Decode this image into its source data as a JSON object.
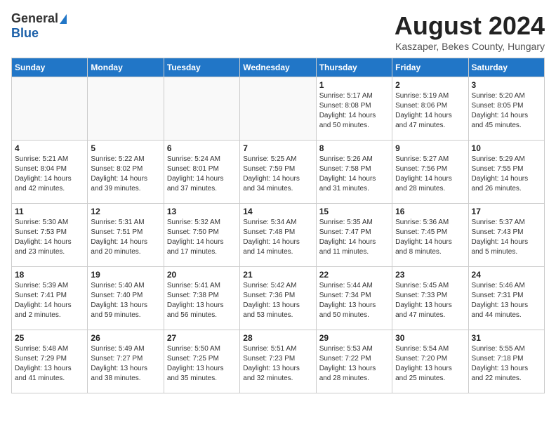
{
  "header": {
    "logo_general": "General",
    "logo_blue": "Blue",
    "month_title": "August 2024",
    "location": "Kaszaper, Bekes County, Hungary"
  },
  "days_of_week": [
    "Sunday",
    "Monday",
    "Tuesday",
    "Wednesday",
    "Thursday",
    "Friday",
    "Saturday"
  ],
  "weeks": [
    [
      {
        "day": "",
        "empty": true
      },
      {
        "day": "",
        "empty": true
      },
      {
        "day": "",
        "empty": true
      },
      {
        "day": "",
        "empty": true
      },
      {
        "day": "1",
        "sunrise": "5:17 AM",
        "sunset": "8:08 PM",
        "daylight": "14 hours and 50 minutes."
      },
      {
        "day": "2",
        "sunrise": "5:19 AM",
        "sunset": "8:06 PM",
        "daylight": "14 hours and 47 minutes."
      },
      {
        "day": "3",
        "sunrise": "5:20 AM",
        "sunset": "8:05 PM",
        "daylight": "14 hours and 45 minutes."
      }
    ],
    [
      {
        "day": "4",
        "sunrise": "5:21 AM",
        "sunset": "8:04 PM",
        "daylight": "14 hours and 42 minutes."
      },
      {
        "day": "5",
        "sunrise": "5:22 AM",
        "sunset": "8:02 PM",
        "daylight": "14 hours and 39 minutes."
      },
      {
        "day": "6",
        "sunrise": "5:24 AM",
        "sunset": "8:01 PM",
        "daylight": "14 hours and 37 minutes."
      },
      {
        "day": "7",
        "sunrise": "5:25 AM",
        "sunset": "7:59 PM",
        "daylight": "14 hours and 34 minutes."
      },
      {
        "day": "8",
        "sunrise": "5:26 AM",
        "sunset": "7:58 PM",
        "daylight": "14 hours and 31 minutes."
      },
      {
        "day": "9",
        "sunrise": "5:27 AM",
        "sunset": "7:56 PM",
        "daylight": "14 hours and 28 minutes."
      },
      {
        "day": "10",
        "sunrise": "5:29 AM",
        "sunset": "7:55 PM",
        "daylight": "14 hours and 26 minutes."
      }
    ],
    [
      {
        "day": "11",
        "sunrise": "5:30 AM",
        "sunset": "7:53 PM",
        "daylight": "14 hours and 23 minutes."
      },
      {
        "day": "12",
        "sunrise": "5:31 AM",
        "sunset": "7:51 PM",
        "daylight": "14 hours and 20 minutes."
      },
      {
        "day": "13",
        "sunrise": "5:32 AM",
        "sunset": "7:50 PM",
        "daylight": "14 hours and 17 minutes."
      },
      {
        "day": "14",
        "sunrise": "5:34 AM",
        "sunset": "7:48 PM",
        "daylight": "14 hours and 14 minutes."
      },
      {
        "day": "15",
        "sunrise": "5:35 AM",
        "sunset": "7:47 PM",
        "daylight": "14 hours and 11 minutes."
      },
      {
        "day": "16",
        "sunrise": "5:36 AM",
        "sunset": "7:45 PM",
        "daylight": "14 hours and 8 minutes."
      },
      {
        "day": "17",
        "sunrise": "5:37 AM",
        "sunset": "7:43 PM",
        "daylight": "14 hours and 5 minutes."
      }
    ],
    [
      {
        "day": "18",
        "sunrise": "5:39 AM",
        "sunset": "7:41 PM",
        "daylight": "14 hours and 2 minutes."
      },
      {
        "day": "19",
        "sunrise": "5:40 AM",
        "sunset": "7:40 PM",
        "daylight": "13 hours and 59 minutes."
      },
      {
        "day": "20",
        "sunrise": "5:41 AM",
        "sunset": "7:38 PM",
        "daylight": "13 hours and 56 minutes."
      },
      {
        "day": "21",
        "sunrise": "5:42 AM",
        "sunset": "7:36 PM",
        "daylight": "13 hours and 53 minutes."
      },
      {
        "day": "22",
        "sunrise": "5:44 AM",
        "sunset": "7:34 PM",
        "daylight": "13 hours and 50 minutes."
      },
      {
        "day": "23",
        "sunrise": "5:45 AM",
        "sunset": "7:33 PM",
        "daylight": "13 hours and 47 minutes."
      },
      {
        "day": "24",
        "sunrise": "5:46 AM",
        "sunset": "7:31 PM",
        "daylight": "13 hours and 44 minutes."
      }
    ],
    [
      {
        "day": "25",
        "sunrise": "5:48 AM",
        "sunset": "7:29 PM",
        "daylight": "13 hours and 41 minutes."
      },
      {
        "day": "26",
        "sunrise": "5:49 AM",
        "sunset": "7:27 PM",
        "daylight": "13 hours and 38 minutes."
      },
      {
        "day": "27",
        "sunrise": "5:50 AM",
        "sunset": "7:25 PM",
        "daylight": "13 hours and 35 minutes."
      },
      {
        "day": "28",
        "sunrise": "5:51 AM",
        "sunset": "7:23 PM",
        "daylight": "13 hours and 32 minutes."
      },
      {
        "day": "29",
        "sunrise": "5:53 AM",
        "sunset": "7:22 PM",
        "daylight": "13 hours and 28 minutes."
      },
      {
        "day": "30",
        "sunrise": "5:54 AM",
        "sunset": "7:20 PM",
        "daylight": "13 hours and 25 minutes."
      },
      {
        "day": "31",
        "sunrise": "5:55 AM",
        "sunset": "7:18 PM",
        "daylight": "13 hours and 22 minutes."
      }
    ]
  ]
}
